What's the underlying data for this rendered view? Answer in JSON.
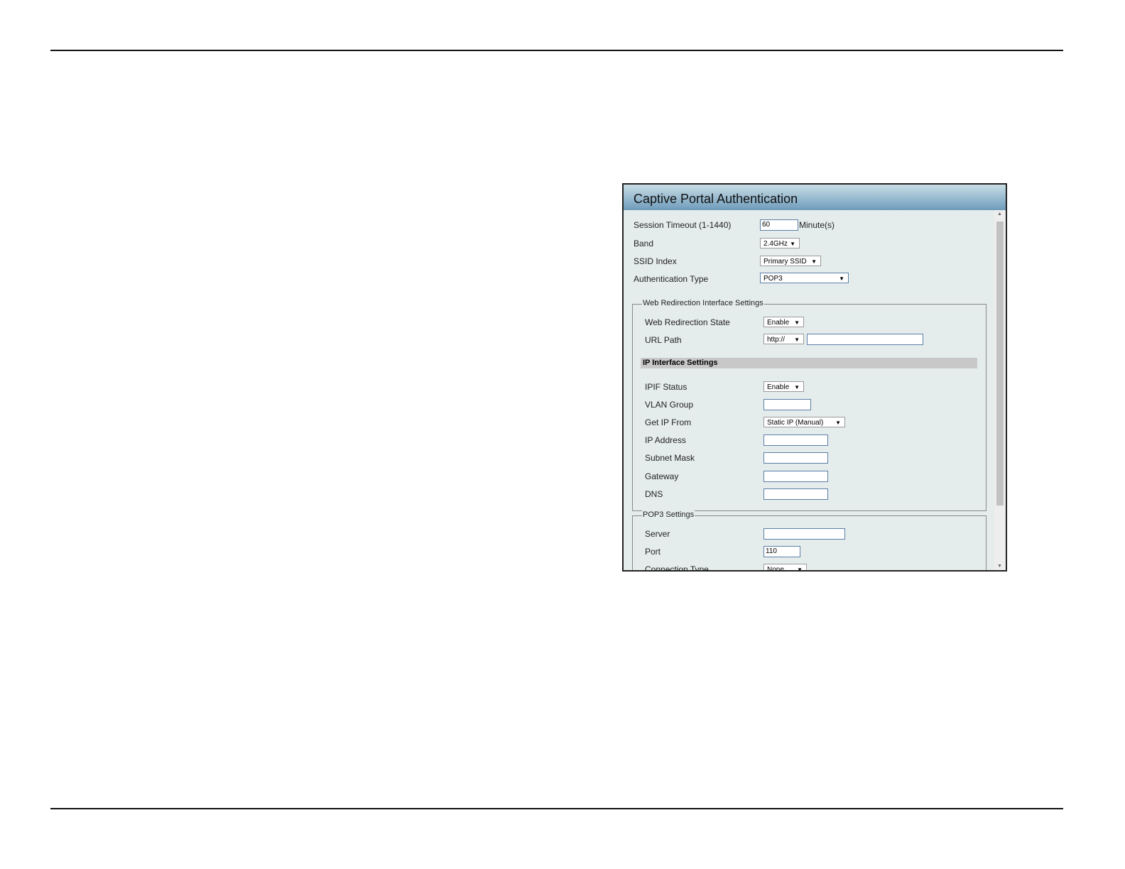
{
  "title": "Captive Portal Authentication",
  "fields": {
    "session_timeout": {
      "label": "Session Timeout (1-1440)",
      "value": "60",
      "unit": "Minute(s)"
    },
    "band": {
      "label": "Band",
      "value": "2.4GHz"
    },
    "ssid_index": {
      "label": "SSID Index",
      "value": "Primary SSID"
    },
    "auth_type": {
      "label": "Authentication Type",
      "value": "POP3"
    }
  },
  "web_redirection": {
    "legend": "Web Redirection Interface Settings",
    "state": {
      "label": "Web Redirection State",
      "value": "Enable"
    },
    "url_path": {
      "label": "URL Path",
      "protocol": "http://",
      "value": ""
    }
  },
  "ip_interface": {
    "title": "IP Interface Settings",
    "ipif_status": {
      "label": "IPIF Status",
      "value": "Enable"
    },
    "vlan_group": {
      "label": "VLAN Group",
      "value": ""
    },
    "get_ip_from": {
      "label": "Get IP From",
      "value": "Static IP (Manual)"
    },
    "ip_address": {
      "label": "IP Address",
      "value": ""
    },
    "subnet_mask": {
      "label": "Subnet Mask",
      "value": ""
    },
    "gateway": {
      "label": "Gateway",
      "value": ""
    },
    "dns": {
      "label": "DNS",
      "value": ""
    }
  },
  "pop3": {
    "legend": "POP3 Settings",
    "server": {
      "label": "Server",
      "value": ""
    },
    "port": {
      "label": "Port",
      "value": "110"
    },
    "connection_type": {
      "label": "Connection Type",
      "value": "None"
    }
  },
  "arrow": "▼"
}
